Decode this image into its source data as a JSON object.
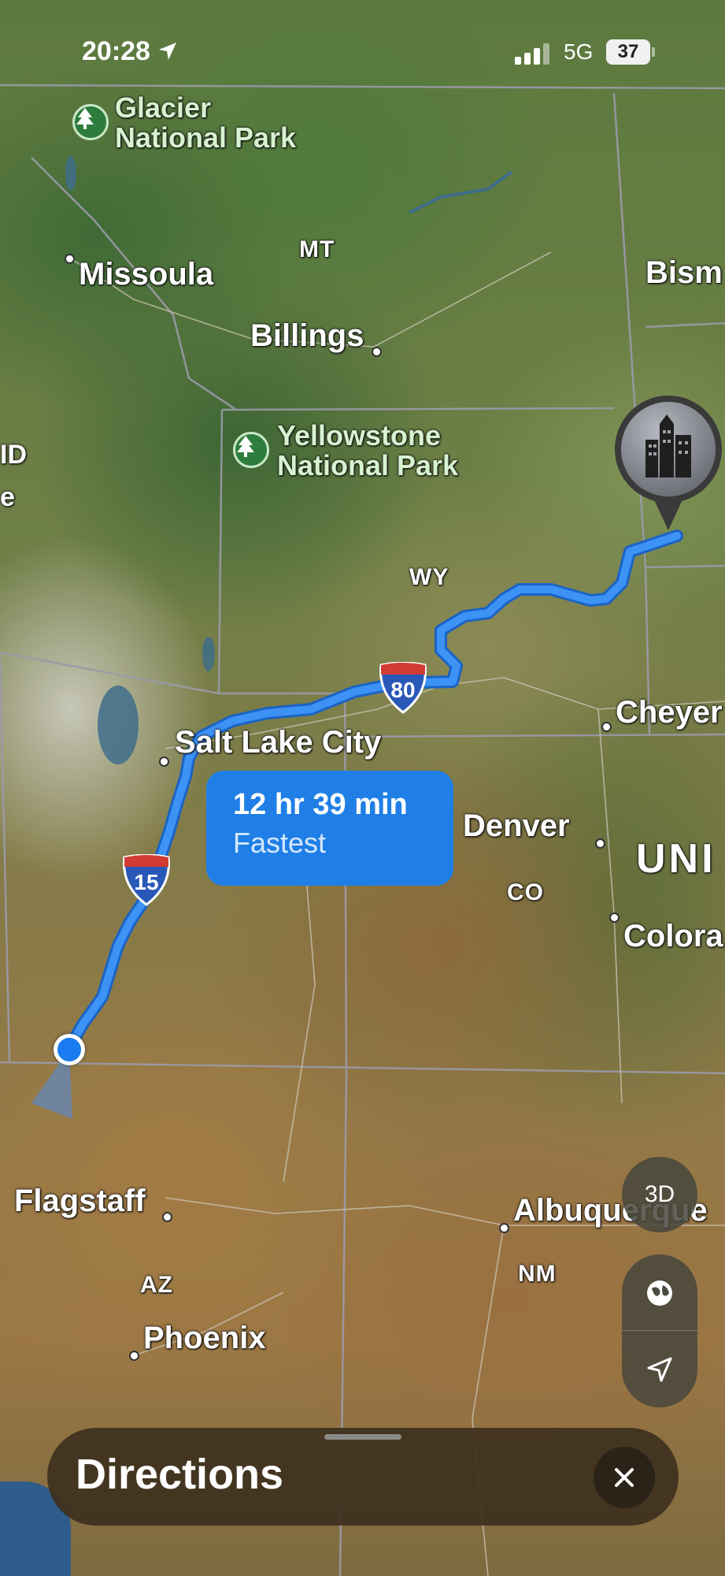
{
  "status_bar": {
    "time": "20:28",
    "network": "5G",
    "battery": "37"
  },
  "map_labels": {
    "parks": {
      "glacier": "Glacier\nNational Park",
      "yellowstone": "Yellowstone\nNational Park"
    },
    "cities": {
      "missoula": "Missoula",
      "billings": "Billings",
      "bismarck": "Bism",
      "salt_lake_city": "Salt Lake City",
      "cheyenne": "Cheyer",
      "denver": "Denver",
      "colorado_springs": "Colora",
      "flagstaff": "Flagstaff",
      "albuquerque": "Albuquerque",
      "phoenix": "Phoenix",
      "id_partial_1": "ID",
      "id_partial_2": "e"
    },
    "states": {
      "mt": "MT",
      "wy": "WY",
      "co": "CO",
      "az": "AZ",
      "nm": "NM",
      "country_partial": "UNI"
    }
  },
  "route": {
    "duration": "12 hr 39 min",
    "label": "Fastest",
    "route_color": "#2f86f0"
  },
  "highway_shields": {
    "i80": "80",
    "i15": "15"
  },
  "controls": {
    "view_3d": "3D",
    "globe_icon": "globe-icon",
    "location_icon": "location-arrow-icon"
  },
  "sheet": {
    "title": "Directions",
    "close_icon": "close-icon"
  }
}
